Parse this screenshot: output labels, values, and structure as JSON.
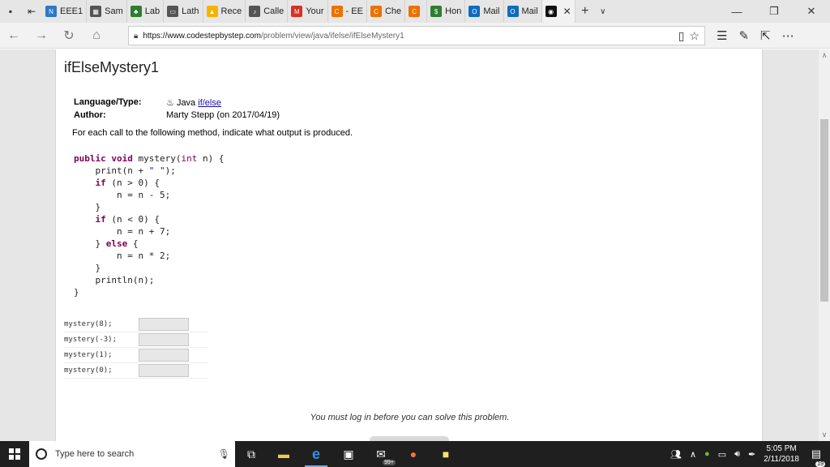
{
  "tabs": [
    {
      "label": "EEE1",
      "icon": "onenote-icon",
      "color": "#2b78c7",
      "glyph": "N"
    },
    {
      "label": "Sam",
      "icon": "calculator-icon",
      "color": "#555555",
      "glyph": "▦"
    },
    {
      "label": "Lab",
      "icon": "pin-icon",
      "color": "#2e7d32",
      "glyph": "♣"
    },
    {
      "label": "Lath",
      "icon": "window-icon",
      "color": "#555555",
      "glyph": "▭"
    },
    {
      "label": "Rece",
      "icon": "drive-icon",
      "color": "#f4b400",
      "glyph": "▲"
    },
    {
      "label": "Calle",
      "icon": "speaker-icon",
      "color": "#555555",
      "glyph": "♪"
    },
    {
      "label": "Your",
      "icon": "gmail-icon",
      "color": "#d93025",
      "glyph": "M"
    },
    {
      "label": "- EE",
      "icon": "chegg-icon",
      "color": "#eb7100",
      "glyph": "C"
    },
    {
      "label": "Che",
      "icon": "chegg-icon",
      "color": "#eb7100",
      "glyph": "C"
    },
    {
      "label": "",
      "icon": "chegg-icon",
      "color": "#eb7100",
      "glyph": "C"
    },
    {
      "label": "Hon",
      "icon": "dollar-icon",
      "color": "#2e7d32",
      "glyph": "$"
    },
    {
      "label": "Mail",
      "icon": "outlook-icon",
      "color": "#0f6cbd",
      "glyph": "O"
    },
    {
      "label": "Mail",
      "icon": "outlook-icon",
      "color": "#0f6cbd",
      "glyph": "O"
    },
    {
      "label": "",
      "icon": "codestepbystep-icon",
      "color": "#111111",
      "glyph": "◉",
      "active": true
    }
  ],
  "address": {
    "host": "https://www.codestepbystep.com",
    "path": "/problem/view/java/ifelse/ifElseMystery1"
  },
  "problem": {
    "title": "ifElseMystery1",
    "language_label": "Language/Type:",
    "language_value": "Java",
    "language_link": "if/else",
    "author_label": "Author:",
    "author_value": "Marty Stepp (on 2017/04/19)",
    "instructions": "For each call to the following method, indicate what output is produced."
  },
  "code_lines": [
    {
      "t": "public void mystery(int n) {",
      "k": [
        "public",
        "void",
        "int"
      ]
    },
    {
      "t": "    print(n + \" \");"
    },
    {
      "t": "    if (n > 0) {",
      "k": [
        "if"
      ]
    },
    {
      "t": "        n = n - 5;"
    },
    {
      "t": "    }"
    },
    {
      "t": "    if (n < 0) {",
      "k": [
        "if"
      ]
    },
    {
      "t": "        n = n + 7;"
    },
    {
      "t": "    } else {",
      "k": [
        "else"
      ]
    },
    {
      "t": "        n = n * 2;"
    },
    {
      "t": "    }"
    },
    {
      "t": "    println(n);"
    },
    {
      "t": "}"
    }
  ],
  "calls": [
    {
      "code": "mystery(8);",
      "value": ""
    },
    {
      "code": "mystery(-3);",
      "value": ""
    },
    {
      "code": "mystery(1);",
      "value": ""
    },
    {
      "code": "mystery(0);",
      "value": ""
    }
  ],
  "login_message": "You must log in before you can solve this problem.",
  "taskbar": {
    "search_placeholder": "Type here to search",
    "clock_time": "5:05 PM",
    "clock_date": "2/11/2018",
    "mail_badge": "99+",
    "notification_badge": "19"
  }
}
